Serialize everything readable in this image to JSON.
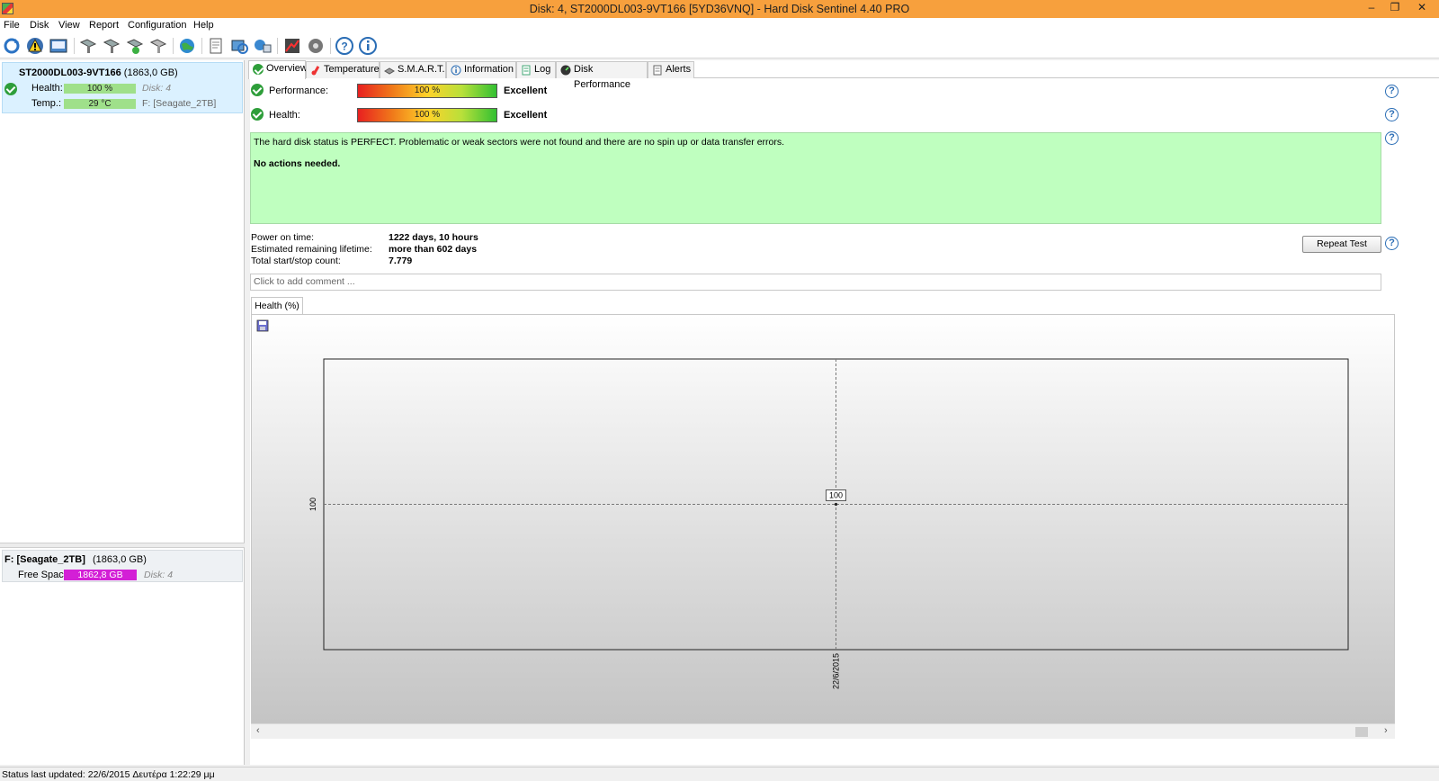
{
  "window": {
    "title": "Disk: 4, ST2000DL003-9VT166 [5YD36VNQ]  -  Hard Disk Sentinel 4.40 PRO",
    "minimize": "–",
    "restore": "❐",
    "close": "✕"
  },
  "menu": [
    "File",
    "Disk",
    "View",
    "Report",
    "Configuration",
    "Help"
  ],
  "toolbar": [
    "refresh-icon",
    "alert-icon",
    "report-icon",
    "disk-tool-icon",
    "disk-tool-icon",
    "disk-tool-icon",
    "disk-tool-icon",
    "web-icon",
    "document-icon",
    "sync-icon",
    "network-icon",
    "chart-icon",
    "settings-icon",
    "help-icon",
    "info-icon"
  ],
  "disk": {
    "name": "ST2000DL003-9VT166",
    "size": "(1863,0 GB)",
    "health_label": "Health:",
    "health_value": "100 %",
    "health_fraction": 1.0,
    "disk_label": "Disk: 4",
    "temp_label": "Temp.:",
    "temp_value": "29 °C",
    "partition": "F: [Seagate_2TB]"
  },
  "volume": {
    "name": "F: [Seagate_2TB]",
    "size": "(1863,0 GB)",
    "free_label": "Free Space",
    "free_value": "1862,8 GB",
    "disk_label": "Disk: 4"
  },
  "tabs": [
    "Overview",
    "Temperature",
    "S.M.A.R.T.",
    "Information",
    "Log",
    "Disk Performance",
    "Alerts"
  ],
  "overview": {
    "performance_label": "Performance:",
    "performance_value": "100 %",
    "performance_fraction": 1.0,
    "performance_rating": "Excellent",
    "health_label": "Health:",
    "health_value": "100 %",
    "health_fraction": 1.0,
    "health_rating": "Excellent",
    "status_message": "The hard disk status is PERFECT. Problematic or weak sectors were not found and there are no spin up or data transfer errors.",
    "action_message": "No actions needed.",
    "power_on_label": "Power on time:",
    "power_on_value": "1222 days, 10 hours",
    "lifetime_label": "Estimated remaining lifetime:",
    "lifetime_value": "more than 602 days",
    "startstop_label": "Total start/stop count:",
    "startstop_value": "7.779",
    "repeat_button": "Repeat Test",
    "comment_placeholder": "Click to add comment ...",
    "help_symbol": "?"
  },
  "chart_tab": "Health (%)",
  "chart_data": {
    "type": "line",
    "x": [
      "22/6/2015"
    ],
    "series": [
      {
        "values": [
          100
        ]
      }
    ],
    "ytick": "100",
    "xtick": "22/6/2015",
    "data_label": "100"
  },
  "statusbar": "Status last updated: 22/6/2015 Δευτέρα 1:22:29 μμ"
}
